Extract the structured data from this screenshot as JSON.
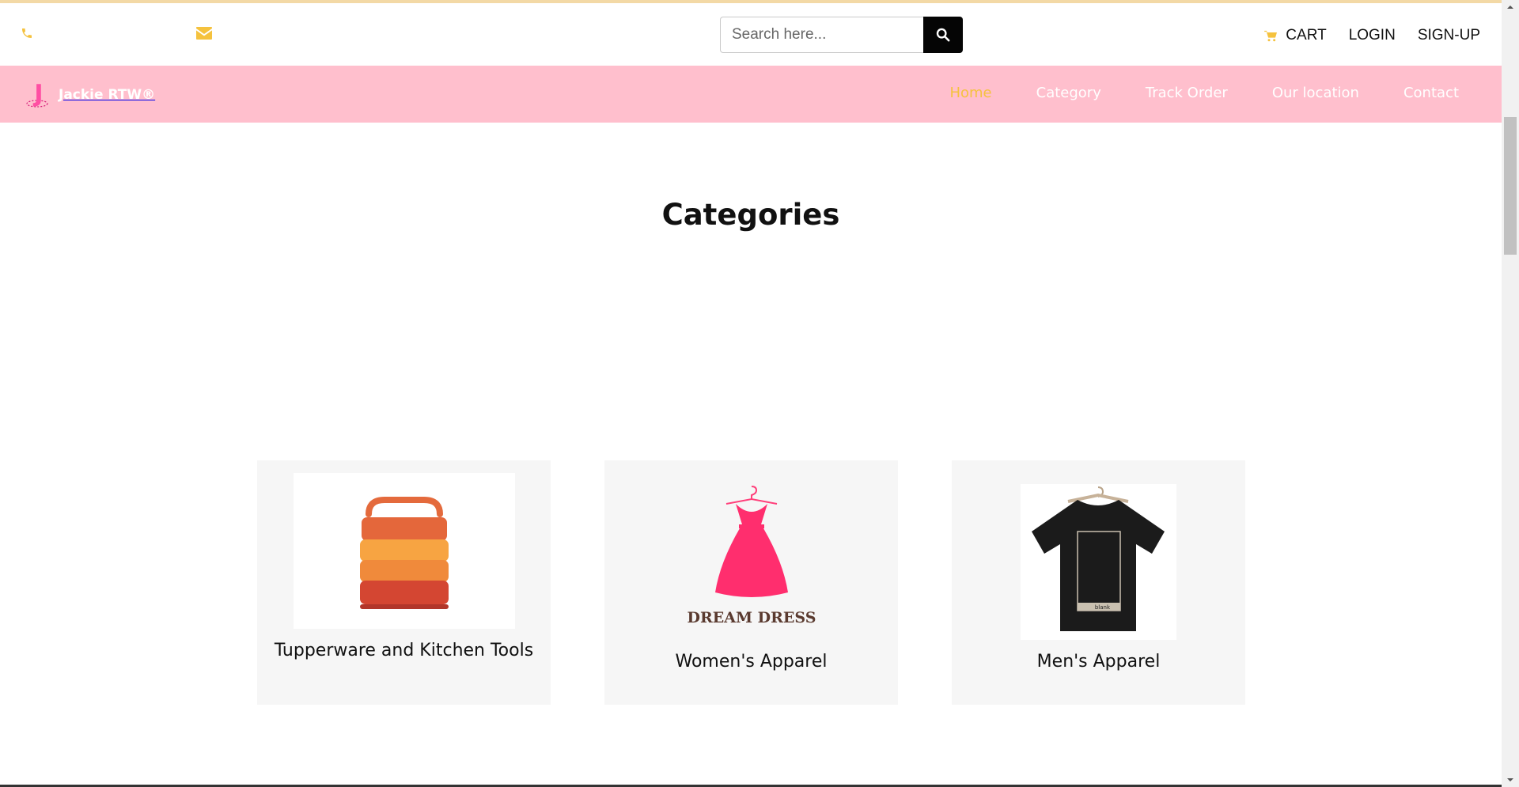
{
  "topbar": {
    "icons": {
      "phone": "phone-icon",
      "email": "envelope-icon",
      "search": "search-icon",
      "cart": "cart-icon"
    },
    "search": {
      "placeholder": "Search here..."
    },
    "links": {
      "cart": "CART",
      "login": "LOGIN",
      "signup": "SIGN-UP"
    }
  },
  "brand": {
    "name": "Jackie RTW®",
    "logo_letter": "J"
  },
  "nav": {
    "items": [
      "Home",
      "Category",
      "Track Order",
      "Our location",
      "Contact"
    ],
    "active": "Home"
  },
  "main": {
    "title": "Categories",
    "categories": [
      {
        "label": "Tupperware and Kitchen Tools"
      },
      {
        "label": "Women's Apparel",
        "image_text": "DREAM DRESS"
      },
      {
        "label": "Men's Apparel",
        "image_text": "blank"
      }
    ]
  },
  "colors": {
    "accent": "#f5c23e",
    "navbar": "#ffbfcd",
    "brand_pink": "#ff4fa3",
    "search_button": "#050505",
    "card_bg": "#f6f6f6"
  }
}
